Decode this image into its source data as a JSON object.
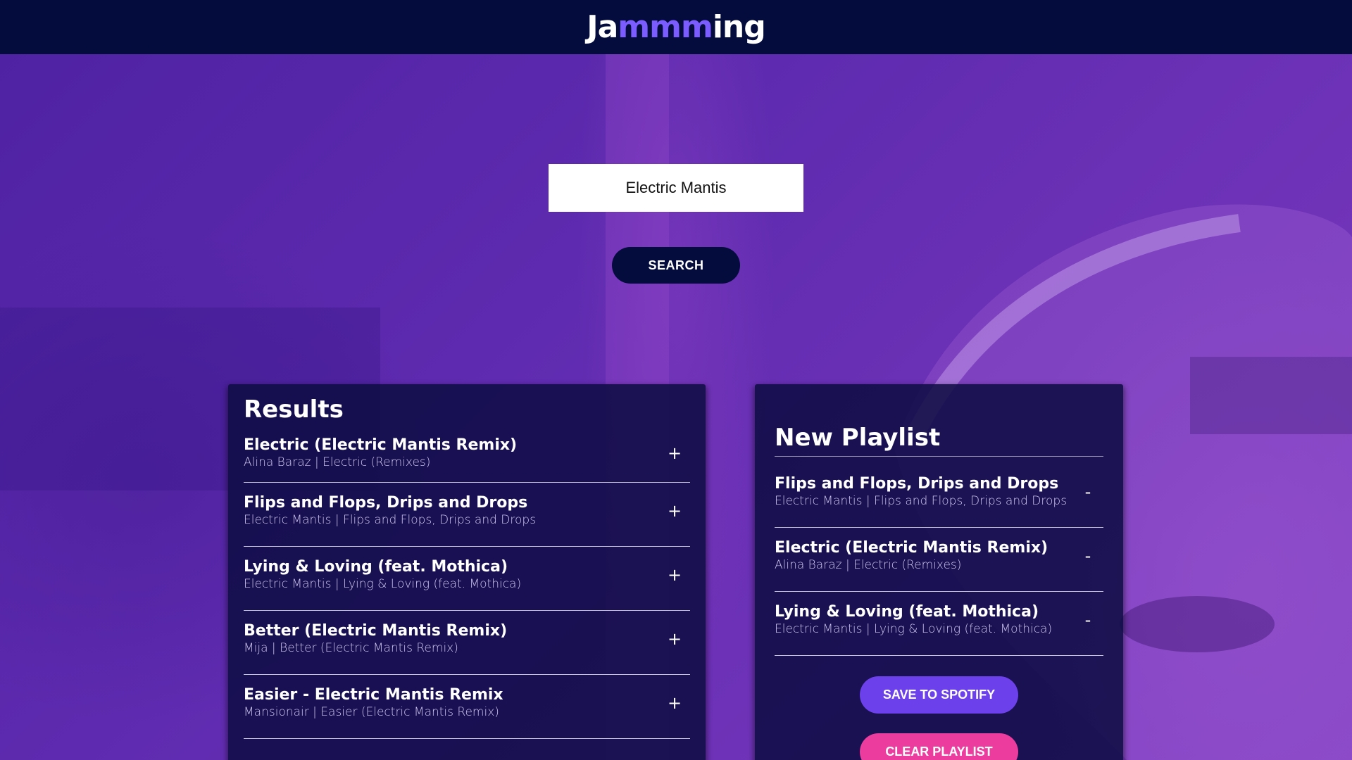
{
  "app": {
    "logo_prefix": "Ja",
    "logo_accent": "mmm",
    "logo_suffix": "ing",
    "colors": {
      "header_bg": "#030c3c",
      "accent": "#7a5cff",
      "save_button": "#6c41ec",
      "clear_button": "#ec3d9f"
    }
  },
  "search": {
    "value": "Electric Mantis",
    "button_label": "SEARCH"
  },
  "results": {
    "title": "Results",
    "action_icon": "+",
    "tracks": [
      {
        "name": "Electric (Electric Mantis Remix)",
        "meta": "Alina Baraz | Electric (Remixes)"
      },
      {
        "name": "Flips and Flops, Drips and Drops",
        "meta": "Electric Mantis | Flips and Flops, Drips and Drops"
      },
      {
        "name": "Lying & Loving (feat. Mothica)",
        "meta": "Electric Mantis | Lying & Loving (feat. Mothica)"
      },
      {
        "name": "Better (Electric Mantis Remix)",
        "meta": "Mija | Better (Electric Mantis Remix)"
      },
      {
        "name": "Easier - Electric Mantis Remix",
        "meta": "Mansionair | Easier (Electric Mantis Remix)"
      }
    ]
  },
  "playlist": {
    "name": "New Playlist",
    "action_icon": "-",
    "tracks": [
      {
        "name": "Flips and Flops, Drips and Drops",
        "meta": "Electric Mantis | Flips and Flops, Drips and Drops"
      },
      {
        "name": "Electric (Electric Mantis Remix)",
        "meta": "Alina Baraz | Electric (Remixes)"
      },
      {
        "name": "Lying & Loving (feat. Mothica)",
        "meta": "Electric Mantis | Lying & Loving (feat. Mothica)"
      }
    ],
    "save_label": "SAVE TO SPOTIFY",
    "clear_label": "CLEAR PLAYLIST"
  }
}
